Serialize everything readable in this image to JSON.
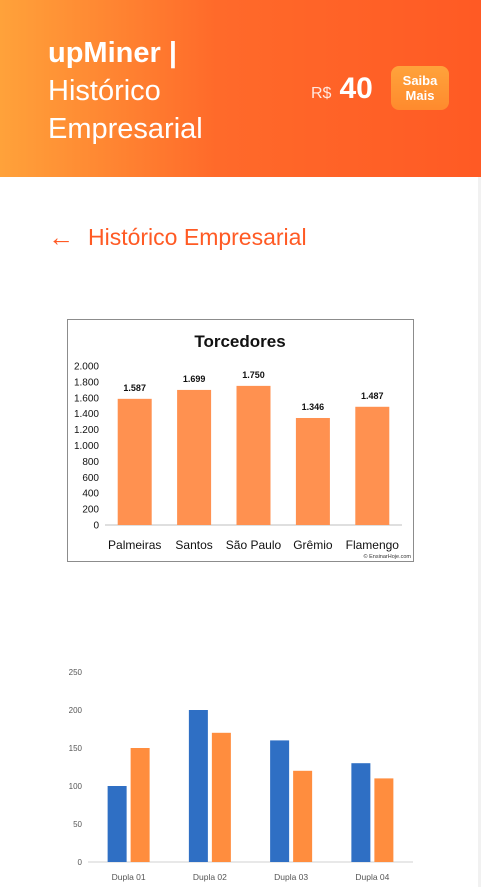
{
  "header": {
    "brand_bold": "upMiner |",
    "brand_line2": "Histórico",
    "brand_line3": "Empresarial",
    "currency": "R$",
    "price": "40",
    "cta_line1": "Saiba",
    "cta_line2": "Mais"
  },
  "nav": {
    "back_arrow": "←",
    "page_title": "Histórico Empresarial"
  },
  "colors": {
    "accent": "#ff5a24",
    "orange_bar": "#ff9150",
    "blue_bar": "#2f6fc4",
    "orange_bar2": "#ff8d3e"
  },
  "chart_data": [
    {
      "type": "bar",
      "title": "Torcedores",
      "categories": [
        "Palmeiras",
        "Santos",
        "São Paulo",
        "Grêmio",
        "Flamengo"
      ],
      "values": [
        1587,
        1699,
        1750,
        1346,
        1487
      ],
      "value_labels": [
        "1.587",
        "1.699",
        "1.750",
        "1.346",
        "1.487"
      ],
      "y_ticks": [
        "0",
        "200",
        "400",
        "600",
        "800",
        "1.000",
        "1.200",
        "1.400",
        "1.600",
        "1.800",
        "2.000"
      ],
      "ylim": [
        0,
        2000
      ],
      "watermark": "© EnsinarHoje.com"
    },
    {
      "type": "bar",
      "categories": [
        "Dupla 01",
        "Dupla 02",
        "Dupla 03",
        "Dupla 04"
      ],
      "series": [
        {
          "values": [
            100,
            200,
            160,
            130
          ]
        },
        {
          "values": [
            150,
            170,
            120,
            110
          ]
        }
      ],
      "y_ticks": [
        "0",
        "50",
        "100",
        "150",
        "200",
        "250"
      ],
      "ylim": [
        0,
        250
      ]
    }
  ]
}
